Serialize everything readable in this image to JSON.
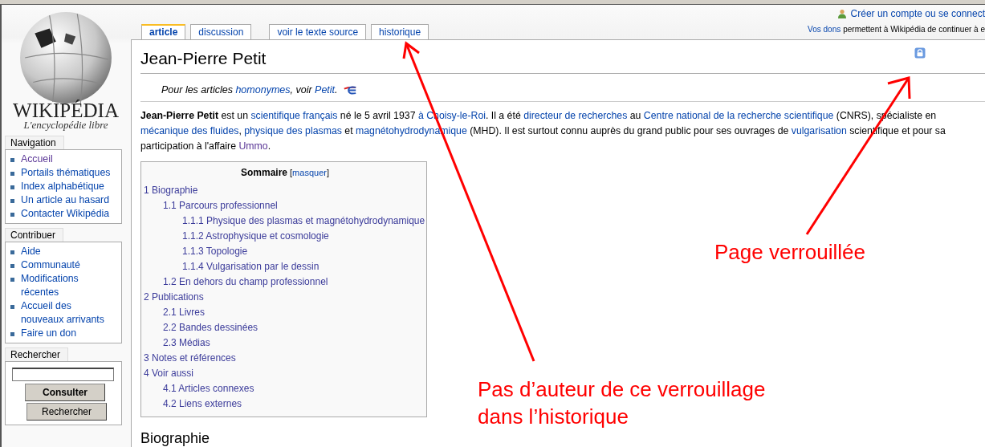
{
  "top_bar": {
    "account_link": "Créer un compte ou se connect",
    "donation_link": "Vos dons",
    "donation_text": "permettent à Wikipédia de continuer à e"
  },
  "logo": {
    "wordmark": "WIKIPÉDIA",
    "tagline": "L'encyclopédie libre"
  },
  "sidebar": [
    {
      "title": "Navigation",
      "kind": "links",
      "items": [
        {
          "label": "Accueil",
          "visited": true
        },
        {
          "label": "Portails thématiques",
          "visited": false
        },
        {
          "label": "Index alphabétique",
          "visited": false
        },
        {
          "label": "Un article au hasard",
          "visited": false
        },
        {
          "label": "Contacter Wikipédia",
          "visited": false
        }
      ]
    },
    {
      "title": "Contribuer",
      "kind": "links",
      "items": [
        {
          "label": "Aide",
          "visited": false
        },
        {
          "label": "Communauté",
          "visited": false
        },
        {
          "label": "Modifications récentes",
          "visited": false
        },
        {
          "label": "Accueil des nouveaux arrivants",
          "visited": false
        },
        {
          "label": "Faire un don",
          "visited": false
        }
      ]
    },
    {
      "title": "Rechercher",
      "kind": "search",
      "buttons": [
        {
          "label": "Consulter",
          "bold": true
        },
        {
          "label": "Rechercher",
          "bold": false
        }
      ]
    }
  ],
  "tabs": [
    {
      "label": "article",
      "selected": true
    },
    {
      "label": "discussion",
      "selected": false
    },
    {
      "label": "voir le texte source",
      "selected": false
    },
    {
      "label": "historique",
      "selected": false
    }
  ],
  "page": {
    "title": "Jean-Pierre Petit",
    "hatnote": [
      {
        "kind": "text",
        "text": "Pour les articles "
      },
      {
        "kind": "link",
        "text": "homonymes"
      },
      {
        "kind": "text",
        "text": ", voir "
      },
      {
        "kind": "link",
        "text": "Petit"
      },
      {
        "kind": "text",
        "text": "."
      }
    ],
    "intro": [
      [
        {
          "kind": "bold",
          "text": "Jean-Pierre Petit"
        },
        {
          "kind": "text",
          "text": " est un "
        },
        {
          "kind": "link",
          "text": "scientifique français"
        },
        {
          "kind": "text",
          "text": " né le 5 avril 1937 "
        },
        {
          "kind": "link",
          "text": "à Choisy-le-Roi"
        },
        {
          "kind": "text",
          "text": ". Il a été "
        },
        {
          "kind": "link",
          "text": "directeur de recherches"
        },
        {
          "kind": "text",
          "text": " au "
        },
        {
          "kind": "link",
          "text": "Centre national de la recherche scientifique"
        },
        {
          "kind": "text",
          "text": " (CNRS), spécialiste en"
        }
      ],
      [
        {
          "kind": "link",
          "text": "mécanique des fluides"
        },
        {
          "kind": "text",
          "text": ", "
        },
        {
          "kind": "link",
          "text": "physique des plasmas"
        },
        {
          "kind": "text",
          "text": " et "
        },
        {
          "kind": "link",
          "text": "magnétohydrodynamique"
        },
        {
          "kind": "text",
          "text": " (MHD). Il est surtout connu auprès du grand public pour ses ouvrages de "
        },
        {
          "kind": "link",
          "text": "vulgarisation"
        },
        {
          "kind": "text",
          "text": " scientifique et pour sa"
        }
      ],
      [
        {
          "kind": "text",
          "text": "participation à l'affaire "
        },
        {
          "kind": "visited",
          "text": "Ummo"
        },
        {
          "kind": "text",
          "text": "."
        }
      ]
    ]
  },
  "toc": {
    "title": "Sommaire",
    "toggle_open": "[",
    "toggle": "masquer",
    "toggle_close": "]",
    "items": [
      {
        "label": "1 Biographie",
        "children": [
          {
            "label": "1.1 Parcours professionnel",
            "children": [
              {
                "label": "1.1.1 Physique des plasmas et magnétohydrodynamique"
              },
              {
                "label": "1.1.2 Astrophysique et cosmologie"
              },
              {
                "label": "1.1.3 Topologie"
              },
              {
                "label": "1.1.4 Vulgarisation par le dessin"
              }
            ]
          },
          {
            "label": "1.2 En dehors du champ professionnel"
          }
        ]
      },
      {
        "label": "2 Publications",
        "children": [
          {
            "label": "2.1 Livres"
          },
          {
            "label": "2.2 Bandes dessinées"
          },
          {
            "label": "2.3 Médias"
          }
        ]
      },
      {
        "label": "3 Notes et références"
      },
      {
        "label": "4 Voir aussi",
        "children": [
          {
            "label": "4.1 Articles connexes"
          },
          {
            "label": "4.2 Liens externes"
          }
        ]
      }
    ]
  },
  "heading": "Biographie",
  "annotations": [
    {
      "text": "Page verrouillée"
    },
    {
      "text": "Pas d’auteur de ce verrouillage\ndans l’historique"
    }
  ]
}
